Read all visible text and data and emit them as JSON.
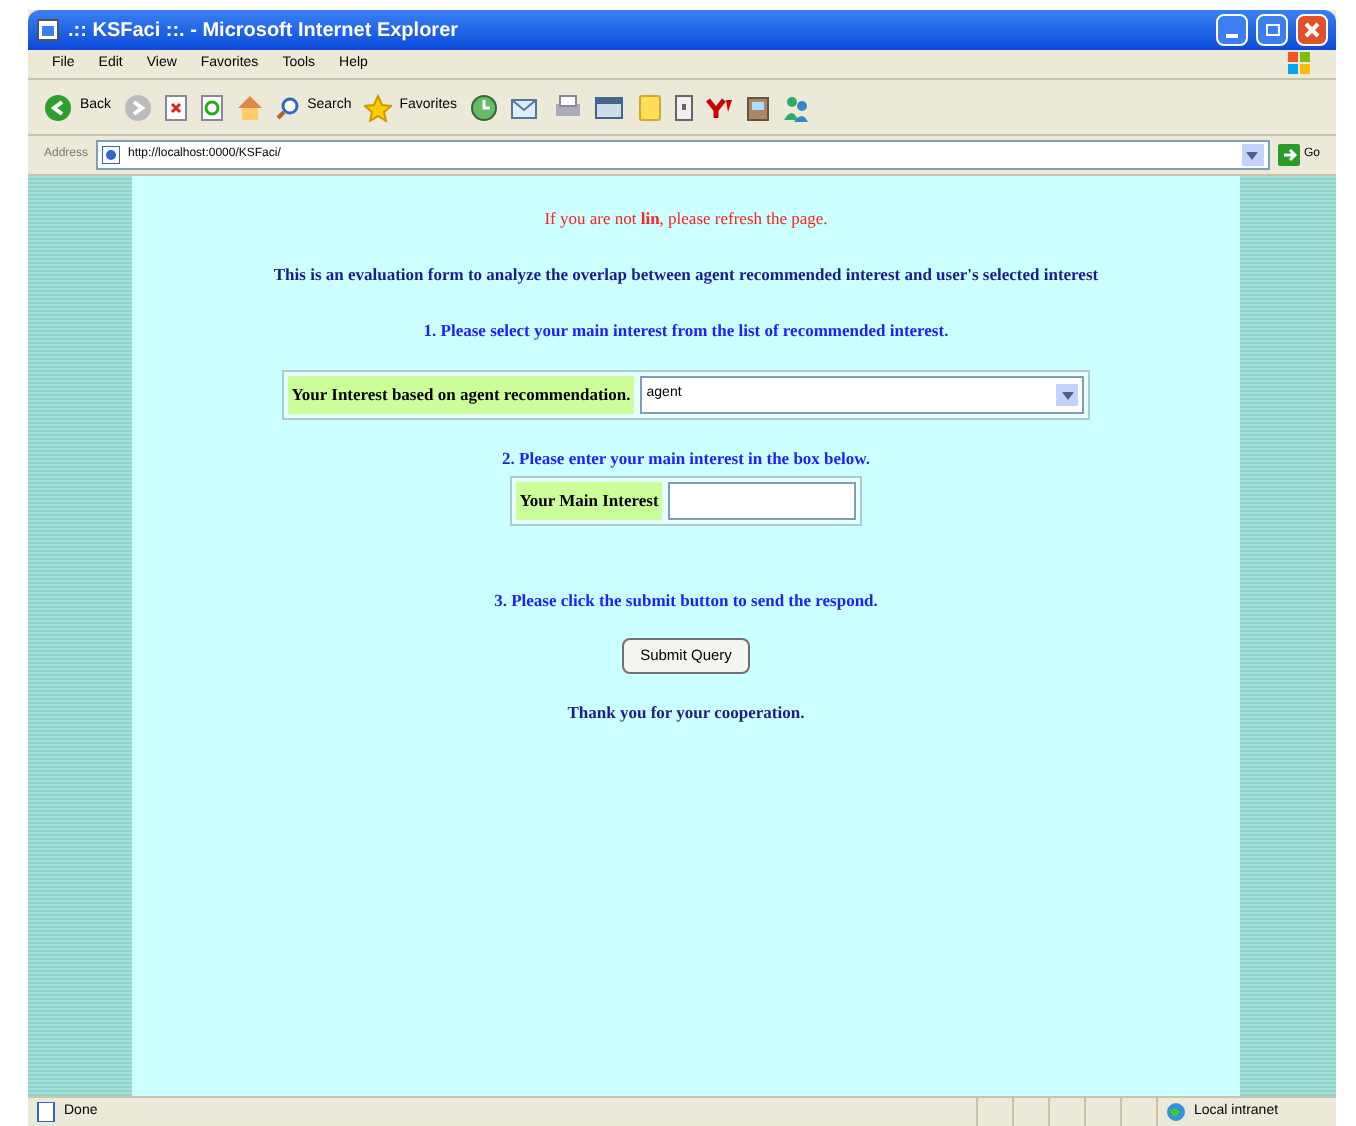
{
  "window": {
    "title": ".:: KSFaci ::. - Microsoft Internet Explorer"
  },
  "menu": [
    "File",
    "Edit",
    "View",
    "Favorites",
    "Tools",
    "Help"
  ],
  "toolbar": {
    "back": "Back",
    "search": "Search",
    "favorites": "Favorites"
  },
  "address": {
    "label": "Address",
    "url": "http://localhost:0000/KSFaci/",
    "go": "Go"
  },
  "page": {
    "notice": "If you are not **lin**, please refresh the page.",
    "intro": "This is an evaluation form to analyze the overlap between agent recommended interest and user's selected interest",
    "step1": "1. Please select your main interest from the list of recommended interest.",
    "select_label": "Your Interest based on agent recommendation.",
    "select_value": "agent",
    "step2": "2. Please enter your main interest in the box below.",
    "input_label": "Your Main Interest",
    "step3": "3. Please click the submit button to send the respond.",
    "submit": "Submit Query",
    "thanks": "Thank you for your cooperation."
  },
  "status_bar": {
    "text": "Done",
    "zone": "Local intranet"
  }
}
